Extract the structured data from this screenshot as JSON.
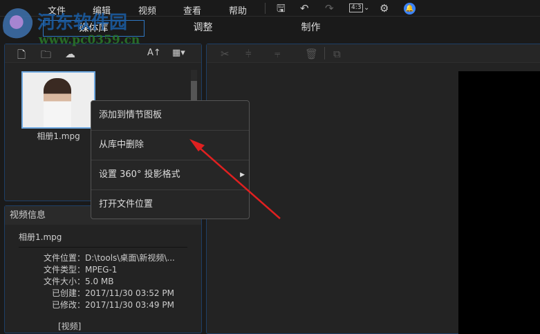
{
  "menu": {
    "items": [
      "文件",
      "编辑",
      "视频",
      "查看",
      "帮助"
    ],
    "aspect": "4:3"
  },
  "tabs": [
    "媒体库",
    "调整",
    "制作"
  ],
  "library": {
    "file_name": "相册1.mpg",
    "sort_label": "A↑"
  },
  "context_menu": [
    "添加到情节图板",
    "从库中删除",
    "设置 360° 投影格式",
    "打开文件位置"
  ],
  "info": {
    "title": "视频信息",
    "file_name": "相册1.mpg",
    "rows": [
      {
        "label": "文件位置：",
        "value": "D:\\tools\\桌面\\新视频\\..."
      },
      {
        "label": "文件类型：",
        "value": "MPEG-1"
      },
      {
        "label": "文件大小：",
        "value": "5.0 MB"
      },
      {
        "label": "已创建：",
        "value": "2017/11/30 03:52 PM"
      },
      {
        "label": "已修改：",
        "value": "2017/11/30 03:49 PM"
      }
    ],
    "section": "[视频]"
  },
  "watermark": {
    "name": "河东软件园",
    "url": "www.pc0359.cn"
  },
  "colors": {
    "accent": "#2f78c4",
    "arrow": "#e02020",
    "bell": "#3b82f6"
  }
}
